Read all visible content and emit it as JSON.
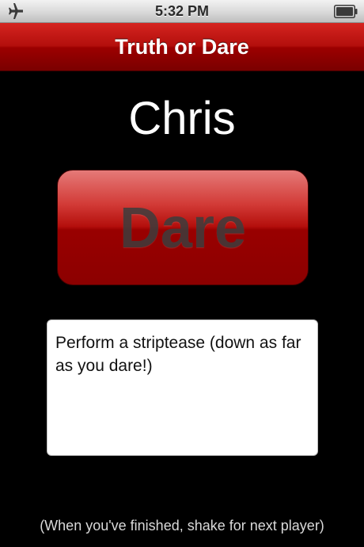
{
  "status_bar": {
    "time": "5:32 PM",
    "airplane_icon": "airplane-icon",
    "battery_icon": "battery-icon"
  },
  "nav_bar": {
    "title": "Truth or Dare"
  },
  "main": {
    "player_name": "Chris",
    "choice_label": "Dare",
    "dare_text": "Perform a striptease (down as far as you dare!)",
    "footer_hint": "(When you've finished, shake for next player)"
  },
  "colors": {
    "accent": "#b30f0c",
    "background": "#000000"
  }
}
